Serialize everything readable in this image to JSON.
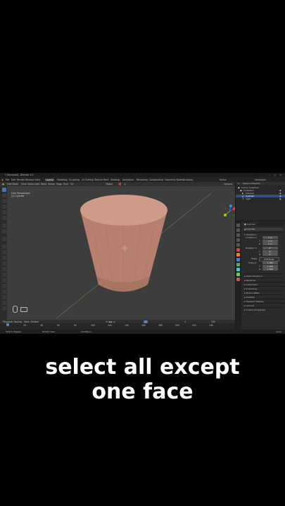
{
  "window": {
    "title": "* [Unsaved] - Blender 4.0",
    "controls": "– □ ×"
  },
  "menu": [
    "File",
    "Edit",
    "Render",
    "Window",
    "Help"
  ],
  "workspaces": [
    "Layout",
    "Modeling",
    "Sculpting",
    "UV Editing",
    "Texture Paint",
    "Shading",
    "Animation",
    "Rendering",
    "Compositing",
    "Geometry Nodes",
    "Scripting"
  ],
  "active_workspace": "Layout",
  "scene": {
    "name": "Scene",
    "layer": "ViewLayer"
  },
  "header3d": {
    "mode": "Edit Mode",
    "items": [
      "View",
      "Select",
      "Add",
      "Mesh",
      "Vertex",
      "Edge",
      "Face",
      "UV"
    ],
    "transform": "Global",
    "options": "Options"
  },
  "viewport": {
    "view_name": "User Perspective",
    "object_label": "(1) Cylinder"
  },
  "outliner": {
    "header": "Scene Collection",
    "rows": [
      {
        "label": "Scene Collection",
        "selected": false
      },
      {
        "label": "Collection",
        "selected": false
      },
      {
        "label": "Camera",
        "selected": false
      },
      {
        "label": "Cylinder",
        "selected": true
      },
      {
        "label": "Light",
        "selected": false
      }
    ]
  },
  "properties": {
    "object": "Cylinder",
    "mesh": "Cylinder",
    "section_transform": "Transform",
    "location_label": "Location X",
    "location": [
      "0 m",
      "0 m",
      "0 m"
    ],
    "rotation_label": "Rotation X",
    "rotation": [
      "0°",
      "0°",
      "0°"
    ],
    "mode_label": "Mode",
    "mode_value": "XYZ Euler",
    "scale_label": "Scale X",
    "scale": [
      "1.000",
      "1.000",
      "1.000"
    ],
    "axis_y": "Y",
    "axis_z": "Z",
    "sections": [
      "Delta Transform",
      "Relations",
      "Collections",
      "Instancing",
      "Motion Paths",
      "Visibility",
      "Viewport Display",
      "Line Art",
      "Custom Properties"
    ]
  },
  "timeline": {
    "menus": [
      "Playback",
      "Keying",
      "View",
      "Marker"
    ],
    "current_frame": "1",
    "start": "1",
    "end": "250",
    "ticks": [
      "0",
      "20",
      "40",
      "60",
      "80",
      "100",
      "120",
      "140",
      "160",
      "180",
      "200",
      "220",
      "240"
    ]
  },
  "statusbar": {
    "left": "Select (Toggle)",
    "middle": "Rotate View",
    "right": "Call Menu",
    "version": "4.0.2"
  },
  "caption": {
    "line1": "select all except",
    "line2": "one face"
  },
  "colors": {
    "accent": "#4772b3",
    "object": "#c8917f",
    "viewport_bg": "#3d3d3d",
    "caption": "#ffffff"
  }
}
